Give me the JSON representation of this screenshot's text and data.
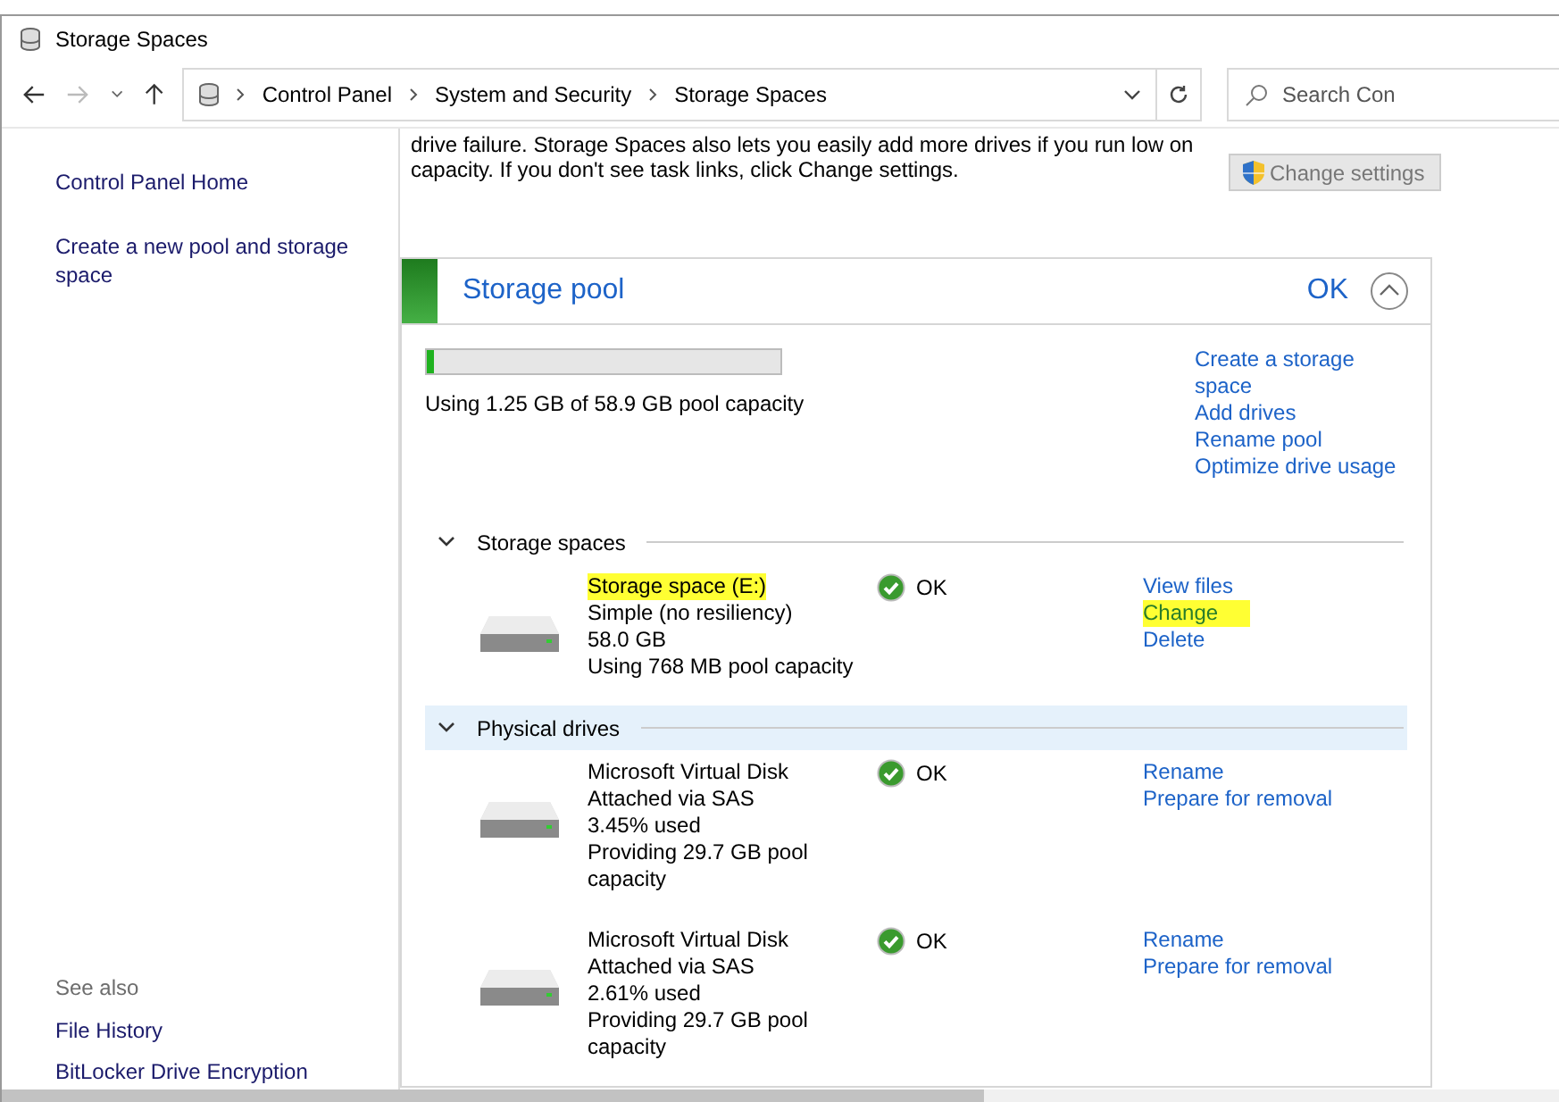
{
  "window": {
    "title": "Storage Spaces"
  },
  "address_bar": {
    "breadcrumbs": [
      "Control Panel",
      "System and Security",
      "Storage Spaces"
    ],
    "search_placeholder": "Search Con"
  },
  "sidebar": {
    "items": [
      {
        "label": "Control Panel Home"
      },
      {
        "label": "Create a new pool and storage space"
      }
    ],
    "see_also_title": "See also",
    "see_also": [
      "File History",
      "BitLocker Drive Encryption"
    ]
  },
  "description": "drive failure. Storage Spaces also lets you easily add more drives if you run low on capacity. If you don't see task links, click Change settings.",
  "change_settings_button": "Change settings",
  "pool": {
    "title": "Storage pool",
    "status": "OK",
    "expanded": true,
    "level": 0.02,
    "usage": "Using 1.25 GB of 58.9 GB pool capacity",
    "tasks": [
      "Create a storage space",
      "Add drives",
      "Rename pool",
      "Optimize drive usage"
    ],
    "sections": [
      {
        "title": "Storage spaces",
        "expanded": true,
        "selected": false,
        "items": [
          {
            "lines": [
              {
                "text": "Storage space (E:)",
                "highlighted": true
              },
              {
                "text": "Simple (no resiliency)",
                "highlighted": false
              },
              {
                "text": "58.0 GB",
                "highlighted": false
              },
              {
                "text": "Using 768 MB pool capacity",
                "highlighted": false
              }
            ],
            "status": "OK",
            "links": [
              {
                "text": "View files",
                "highlighted": false
              },
              {
                "text": "Change",
                "highlighted": true
              },
              {
                "text": "Delete",
                "highlighted": false
              }
            ]
          }
        ]
      },
      {
        "title": "Physical drives",
        "expanded": true,
        "selected": true,
        "items": [
          {
            "lines": [
              {
                "text": "Microsoft Virtual Disk",
                "highlighted": false
              },
              {
                "text": "Attached via SAS",
                "highlighted": false
              },
              {
                "text": "3.45% used",
                "highlighted": false
              },
              {
                "text": "Providing 29.7 GB pool capacity",
                "highlighted": false
              }
            ],
            "status": "OK",
            "links": [
              {
                "text": "Rename",
                "highlighted": false
              },
              {
                "text": "Prepare for removal",
                "highlighted": false
              }
            ]
          },
          {
            "lines": [
              {
                "text": "Microsoft Virtual Disk",
                "highlighted": false
              },
              {
                "text": "Attached via SAS",
                "highlighted": false
              },
              {
                "text": "2.61% used",
                "highlighted": false
              },
              {
                "text": "Providing 29.7 GB pool capacity",
                "highlighted": false
              }
            ],
            "status": "OK",
            "links": [
              {
                "text": "Rename",
                "highlighted": false
              },
              {
                "text": "Prepare for removal",
                "highlighted": false
              }
            ]
          }
        ]
      }
    ]
  }
}
